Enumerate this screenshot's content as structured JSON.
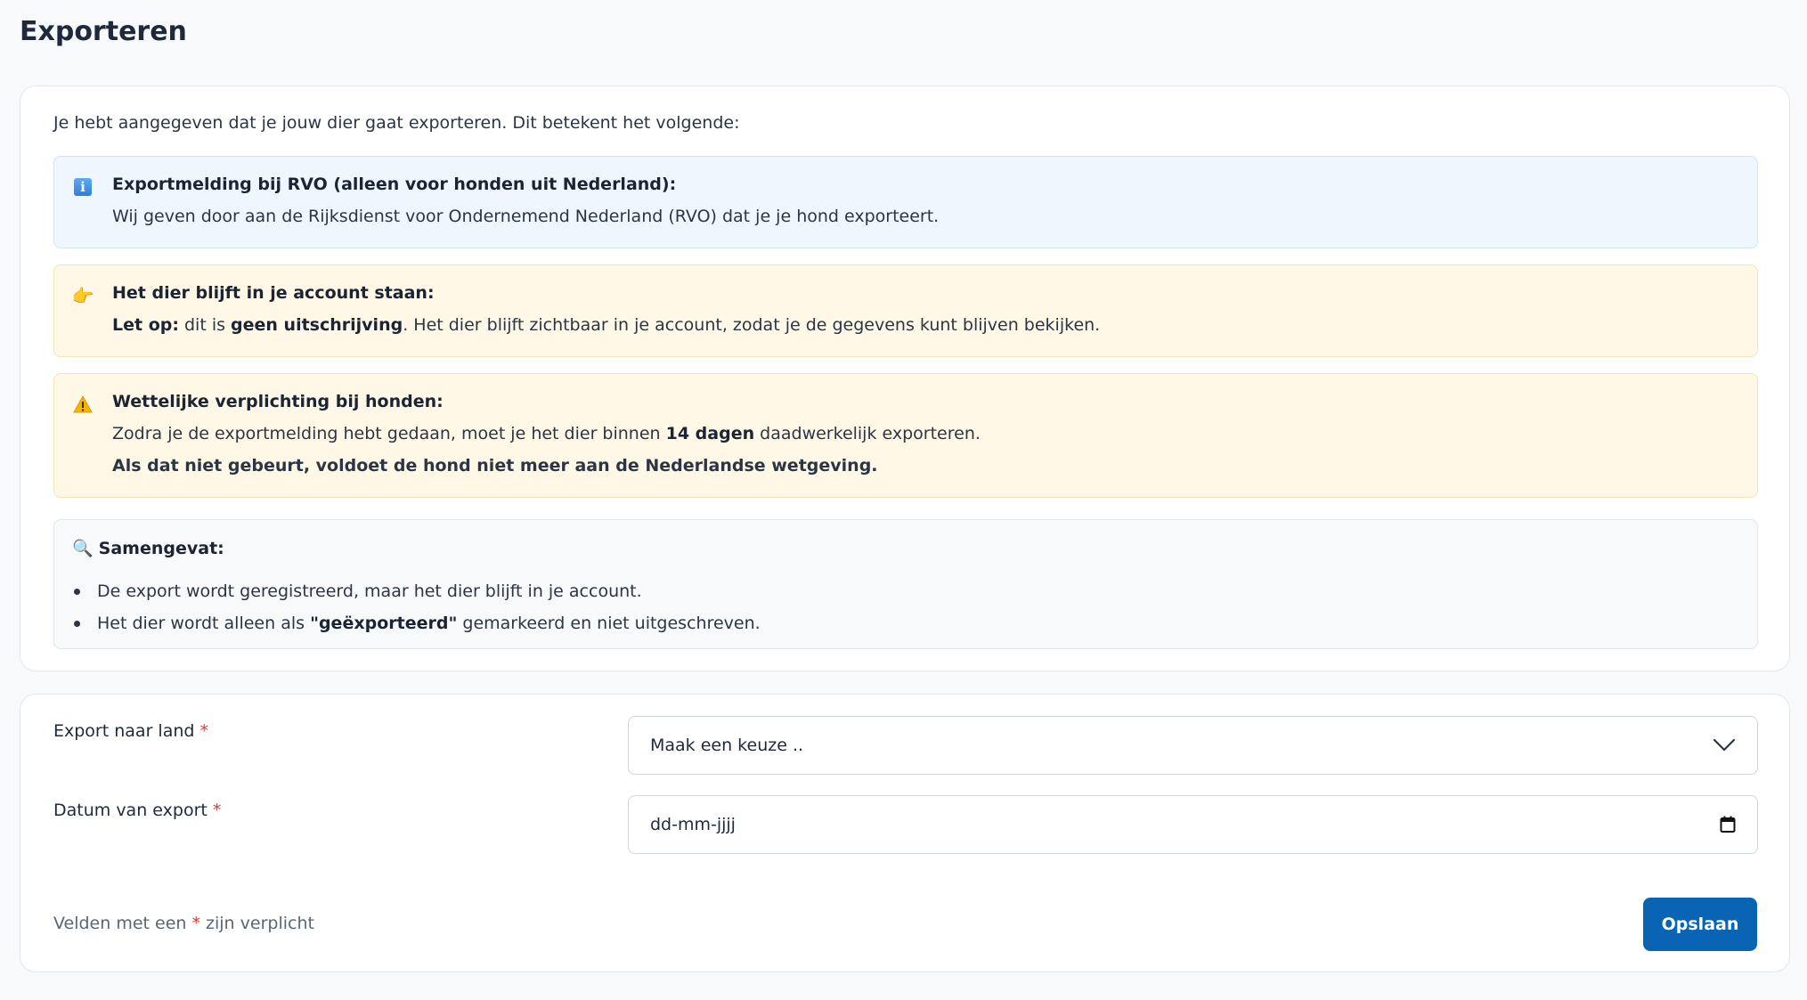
{
  "page": {
    "title": "Exporteren"
  },
  "info": {
    "intro": "Je hebt aangegeven dat je jouw dier gaat exporteren. Dit betekent het volgende:",
    "rvo": {
      "icon": "info-icon",
      "heading": "Exportmelding bij RVO (alleen voor honden uit Nederland):",
      "text": "Wij geven door aan de Rijksdienst voor Ondernemend Nederland (RVO) dat je je hond exporteert."
    },
    "account": {
      "icon": "pointing-hand-icon",
      "heading": "Het dier blijft in je account staan:",
      "letop": "Let op:",
      "mid": " dit is ",
      "emph": "geen uitschrijving",
      "rest": ". Het dier blijft zichtbaar in je account, zodat je de gegevens kunt blijven bekijken."
    },
    "legal": {
      "icon": "warning-icon",
      "heading": "Wettelijke verplichting bij honden:",
      "pre": "Zodra je de exportmelding hebt gedaan, moet je het dier binnen ",
      "emph": "14 dagen",
      "post": " daadwerkelijk exporteren.",
      "line2": "Als dat niet gebeurt, voldoet de hond niet meer aan de Nederlandse wetgeving."
    },
    "summary": {
      "icon": "magnifier-icon",
      "heading": "Samengevat:",
      "item1": "De export wordt geregistreerd, maar het dier blijft in je account.",
      "item2_pre": "Het dier wordt alleen als ",
      "item2_emph": "\"geëxporteerd\"",
      "item2_post": " gemarkeerd en niet uitgeschreven."
    }
  },
  "form": {
    "country_label": "Export naar land",
    "country_value": "Maak een keuze ..",
    "date_label": "Datum van export",
    "date_value": "dd-mm-jjjj",
    "required_mark": "*",
    "footnote_pre": "Velden met een ",
    "footnote_post": " zijn verplicht",
    "save_label": "Opslaan"
  },
  "colors": {
    "primary": "#0a64b4",
    "required": "#e53935",
    "info_bg": "#eff6fd",
    "warning_bg": "#fff8e7"
  }
}
